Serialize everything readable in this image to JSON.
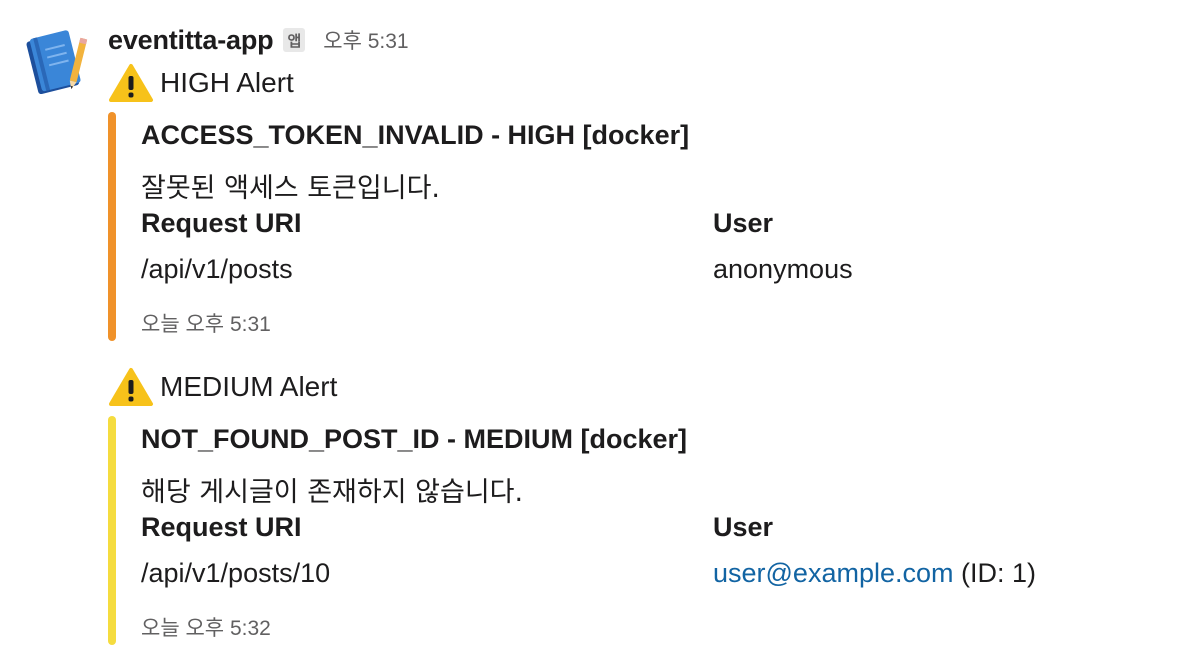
{
  "message": {
    "sender": "eventitta-app",
    "app_badge": "앱",
    "time": "오후 5:31",
    "avatar_icon": "notebook-pencil-icon"
  },
  "alerts": [
    {
      "title": "HIGH Alert",
      "icon": "warning-icon",
      "color": "#f0922a",
      "heading": "ACCESS_TOKEN_INVALID - HIGH [docker]",
      "text": "잘못된 액세스 토큰입니다.",
      "fields": [
        {
          "title": "Request URI",
          "value": "/api/v1/posts"
        },
        {
          "title": "User",
          "value": "anonymous"
        }
      ],
      "footer": "오늘 오후 5:31"
    },
    {
      "title": "MEDIUM Alert",
      "icon": "warning-icon",
      "color": "#f5dc3f",
      "heading": "NOT_FOUND_POST_ID - MEDIUM [docker]",
      "text": "해당 게시글이 존재하지 않습니다.",
      "fields": [
        {
          "title": "Request URI",
          "value": "/api/v1/posts/10"
        },
        {
          "title": "User",
          "link": "user@example.com",
          "suffix": " (ID: 1)"
        }
      ],
      "footer": "오늘 오후 5:32"
    }
  ]
}
